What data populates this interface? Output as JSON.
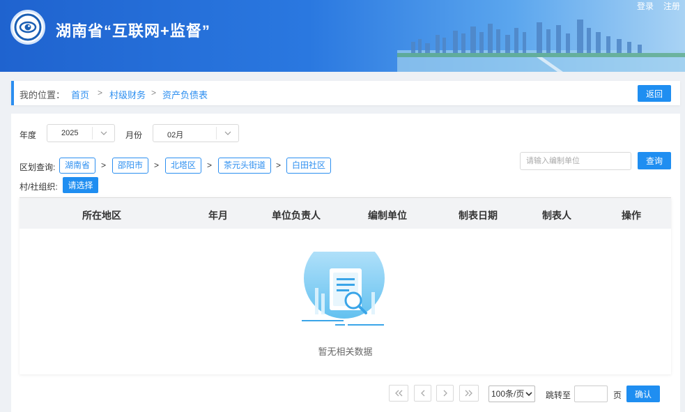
{
  "header": {
    "title": "湖南省“互联网+监督”",
    "login": "登录",
    "register": "注册"
  },
  "breadcrumb": {
    "label": "我的位置：",
    "items": [
      "首页",
      "村级财务",
      "资产负债表"
    ],
    "separator": ">",
    "back_label": "返回"
  },
  "filters": {
    "year_label": "年度",
    "year_value": "2025",
    "month_label": "月份",
    "month_value": "02月",
    "region_label": "区划查询:",
    "region_path": [
      "湖南省",
      "邵阳市",
      "北塔区",
      "茶元头街道",
      "白田社区"
    ],
    "region_separator": ">",
    "org_label": "村/社组织:",
    "org_button": "请选择",
    "search_placeholder": "请输入编制单位",
    "query_label": "查询"
  },
  "table": {
    "columns": [
      "所在地区",
      "年月",
      "单位负责人",
      "编制单位",
      "制表日期",
      "制表人",
      "操作"
    ],
    "rows": [],
    "empty_text": "暂无相关数据"
  },
  "pagination": {
    "page_size": "100条/页",
    "jump_label": "跳转至",
    "page_unit": "页",
    "confirm_label": "确认"
  },
  "colors": {
    "accent": "#1f8ef1",
    "header_start": "#1f63cf",
    "header_end": "#a9d3f4"
  }
}
